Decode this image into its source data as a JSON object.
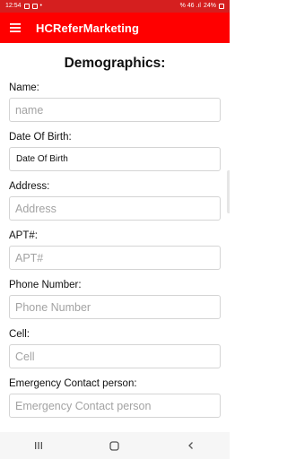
{
  "status_bar": {
    "time": "12:54",
    "battery": "24%",
    "signal_text": "%  46 .ıl"
  },
  "app_bar": {
    "title": "HCReferMarketing",
    "menu_icon": "hamburger-menu-icon"
  },
  "form": {
    "heading": "Demographics:",
    "fields": [
      {
        "label": "Name:",
        "placeholder": "name",
        "value": ""
      },
      {
        "label": "Date Of Birth:",
        "value": "Date Of Birth"
      },
      {
        "label": "Address:",
        "placeholder": "Address",
        "value": ""
      },
      {
        "label": "APT#:",
        "placeholder": "APT#",
        "value": ""
      },
      {
        "label": "Phone Number:",
        "placeholder": "Phone Number",
        "value": ""
      },
      {
        "label": "Cell:",
        "placeholder": "Cell",
        "value": ""
      },
      {
        "label": "Emergency Contact person:",
        "placeholder": "Emergency Contact person",
        "value": ""
      }
    ]
  },
  "nav_bar": {
    "icons": [
      "recent-apps-icon",
      "home-icon",
      "back-icon"
    ]
  },
  "colors": {
    "app_bar": "#ff0000",
    "status_bar": "#d51f1f",
    "text": "#111111",
    "placeholder": "#a3a3a3",
    "border": "#d4d4d4"
  }
}
